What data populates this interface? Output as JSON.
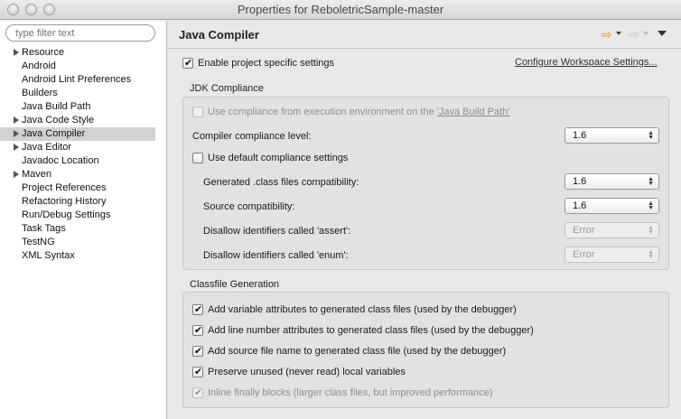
{
  "window": {
    "title": "Properties for ReboletricSample-master"
  },
  "filter": {
    "placeholder": "type filter text"
  },
  "sidebar": {
    "items": [
      {
        "label": "Resource",
        "expandable": true,
        "selected": false
      },
      {
        "label": "Android",
        "expandable": false,
        "selected": false
      },
      {
        "label": "Android Lint Preferences",
        "expandable": false,
        "selected": false
      },
      {
        "label": "Builders",
        "expandable": false,
        "selected": false
      },
      {
        "label": "Java Build Path",
        "expandable": false,
        "selected": false
      },
      {
        "label": "Java Code Style",
        "expandable": true,
        "selected": false
      },
      {
        "label": "Java Compiler",
        "expandable": true,
        "selected": true
      },
      {
        "label": "Java Editor",
        "expandable": true,
        "selected": false
      },
      {
        "label": "Javadoc Location",
        "expandable": false,
        "selected": false
      },
      {
        "label": "Maven",
        "expandable": true,
        "selected": false
      },
      {
        "label": "Project References",
        "expandable": false,
        "selected": false
      },
      {
        "label": "Refactoring History",
        "expandable": false,
        "selected": false
      },
      {
        "label": "Run/Debug Settings",
        "expandable": false,
        "selected": false
      },
      {
        "label": "Task Tags",
        "expandable": false,
        "selected": false
      },
      {
        "label": "TestNG",
        "expandable": false,
        "selected": false
      },
      {
        "label": "XML Syntax",
        "expandable": false,
        "selected": false
      }
    ]
  },
  "main": {
    "title": "Java Compiler",
    "project_specific": {
      "label": "Enable project specific settings",
      "checked": true
    },
    "configure_link": "Configure Workspace Settings...",
    "jdk": {
      "title": "JDK Compliance",
      "use_env": {
        "label_prefix": "Use compliance from execution environment on the ",
        "link": "'Java Build Path'",
        "checked": false,
        "disabled": true
      },
      "compliance_label": "Compiler compliance level:",
      "compliance_value": "1.6",
      "use_default": {
        "label": "Use default compliance settings",
        "checked": false
      },
      "generated_label": "Generated .class files compatibility:",
      "generated_value": "1.6",
      "source_label": "Source compatibility:",
      "source_value": "1.6",
      "assert_label": "Disallow identifiers called 'assert':",
      "assert_value": "Error",
      "enum_label": "Disallow identifiers called 'enum':",
      "enum_value": "Error"
    },
    "classfile": {
      "title": "Classfile Generation",
      "options": [
        {
          "label": "Add variable attributes to generated class files (used by the debugger)",
          "checked": true,
          "disabled": false
        },
        {
          "label": "Add line number attributes to generated class files (used by the debugger)",
          "checked": true,
          "disabled": false
        },
        {
          "label": "Add source file name to generated class file (used by the debugger)",
          "checked": true,
          "disabled": false
        },
        {
          "label": "Preserve unused (never read) local variables",
          "checked": true,
          "disabled": false
        },
        {
          "label": "Inline finally blocks (larger class files, but improved performance)",
          "checked": true,
          "disabled": true
        }
      ]
    }
  }
}
